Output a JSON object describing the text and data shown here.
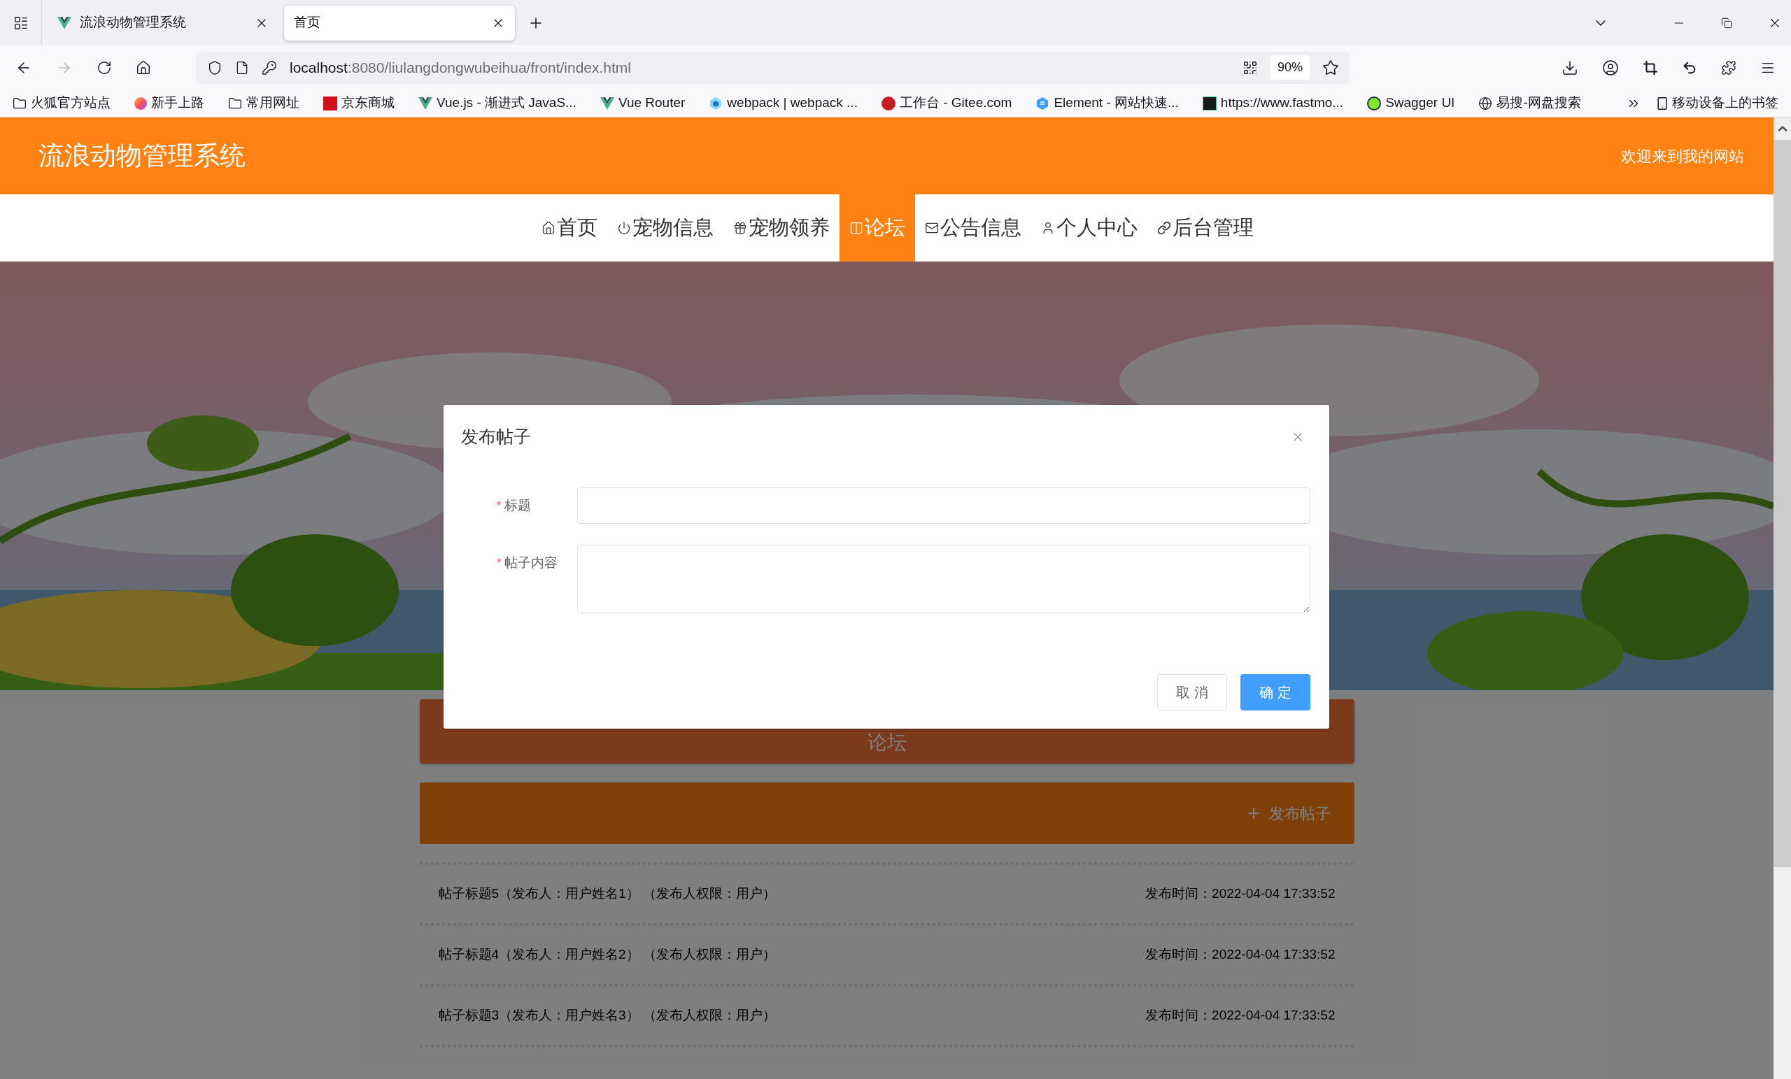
{
  "browser": {
    "tabs": [
      {
        "title": "流浪动物管理系统",
        "selected": false
      },
      {
        "title": "首页",
        "selected": true
      }
    ],
    "url": {
      "host": "localhost",
      "path": ":8080/liulangdongwubeihua/front/index.html"
    },
    "zoom": "90%",
    "bookmarks": [
      {
        "label": "火狐官方站点"
      },
      {
        "label": "新手上路"
      },
      {
        "label": "常用网址"
      },
      {
        "label": "京东商城"
      },
      {
        "label": "Vue.js - 渐进式 JavaS..."
      },
      {
        "label": "Vue Router"
      },
      {
        "label": "webpack | webpack ..."
      },
      {
        "label": "工作台 - Gitee.com"
      },
      {
        "label": "Element - 网站快速..."
      },
      {
        "label": "https://www.fastmo..."
      },
      {
        "label": "Swagger UI"
      },
      {
        "label": "易搜-网盘搜索"
      }
    ],
    "mobile_bookmarks": "移动设备上的书签"
  },
  "site": {
    "title": "流浪动物管理系统",
    "welcome": "欢迎来到我的网站",
    "nav": [
      {
        "label": "首页",
        "selected": false
      },
      {
        "label": "宠物信息",
        "selected": false
      },
      {
        "label": "宠物领养",
        "selected": false
      },
      {
        "label": "论坛",
        "selected": true
      },
      {
        "label": "公告信息",
        "selected": false
      },
      {
        "label": "个人中心",
        "selected": false
      },
      {
        "label": "后台管理",
        "selected": false
      }
    ],
    "forum_title": "论坛",
    "post_button": "发布帖子",
    "posts": [
      {
        "title": "帖子标题5（发布人：用户姓名1） （发布人权限：用户）",
        "time": "发布时间：2022-04-04 17:33:52"
      },
      {
        "title": "帖子标题4（发布人：用户姓名2） （发布人权限：用户）",
        "time": "发布时间：2022-04-04 17:33:52"
      },
      {
        "title": "帖子标题3（发布人：用户姓名3） （发布人权限：用户）",
        "time": "发布时间：2022-04-04 17:33:52"
      }
    ]
  },
  "dialog": {
    "title": "发布帖子",
    "fields": [
      {
        "label": "标题",
        "required_mark": "*",
        "kind": "input"
      },
      {
        "label": "帖子内容",
        "required_mark": "*",
        "kind": "textarea"
      }
    ],
    "buttons": [
      {
        "label": "取 消",
        "kind": "default"
      },
      {
        "label": "确 定",
        "kind": "primary"
      }
    ]
  }
}
